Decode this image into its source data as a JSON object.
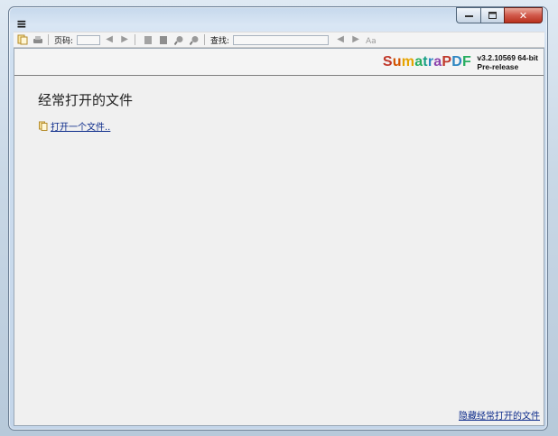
{
  "window": {
    "menu_icon": "hamburger-menu-icon"
  },
  "caption": {
    "min_icon": "minimize-icon",
    "max_icon": "maximize-icon",
    "close_icon": "close-icon",
    "close_glyph": "✕"
  },
  "toolbar": {
    "page_label": "页码:",
    "find_label": "查找:",
    "page_value": "",
    "find_value": ""
  },
  "brand": {
    "name": "SumatraPDF",
    "version_line1": "v3.2.10569 64-bit",
    "version_line2": "Pre-release",
    "letter_colors": [
      "#c0392b",
      "#d35400",
      "#e6a400",
      "#27ae60",
      "#16a085",
      "#2e86c1",
      "#8e44ad",
      "#c0392b",
      "#2e86c1",
      "#27ae60"
    ]
  },
  "main": {
    "frequent_title": "经常打开的文件",
    "open_file_link": "打开一个文件..",
    "hide_frequent_link": "隐藏经常打开的文件"
  }
}
